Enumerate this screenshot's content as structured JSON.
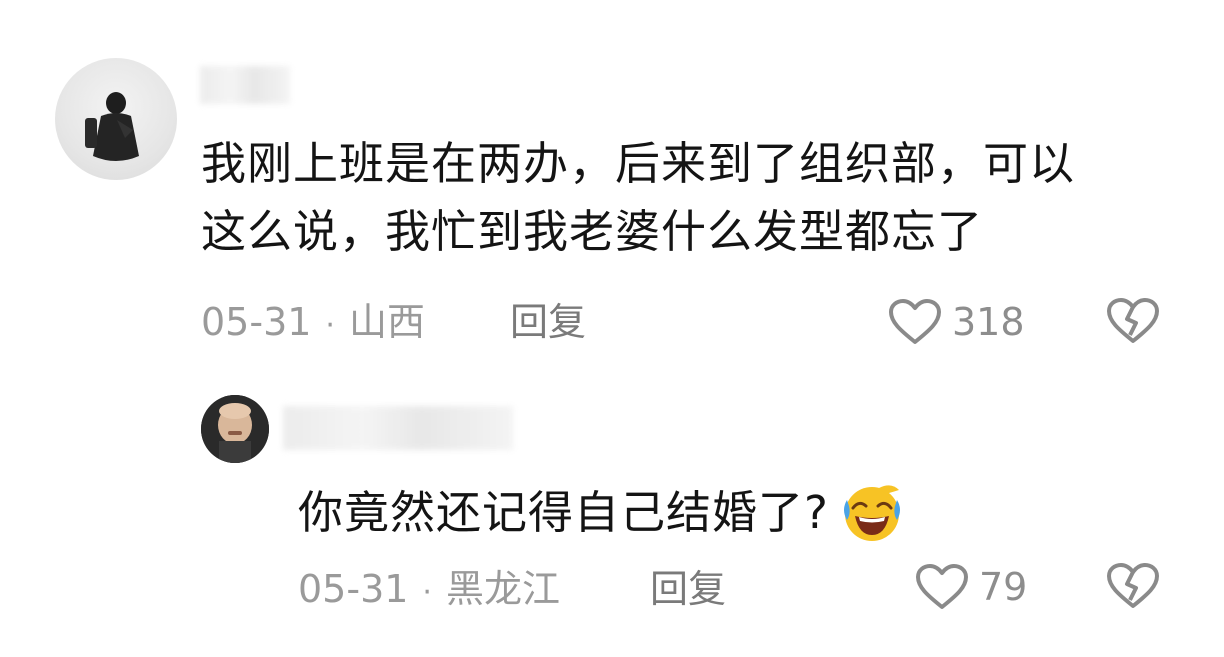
{
  "comment": {
    "text_line1": "我刚上班是在两办，后来到了组织部，可以",
    "text_line2": "这么说，我忙到我老婆什么发型都忘了",
    "date": "05-31",
    "location": "山西",
    "reply_label": "回复",
    "like_count": "318"
  },
  "reply": {
    "text": "你竟然还记得自己结婚了?",
    "emoji": "grinning-tears-emoji",
    "date": "05-31",
    "location": "黑龙江",
    "reply_label": "回复",
    "like_count": "79"
  },
  "icons": {
    "like": "heart-outline-icon",
    "dislike": "broken-heart-icon"
  },
  "colors": {
    "text": "#141414",
    "meta": "#9a9a9a",
    "icon": "#8a8a8a",
    "emoji_face": "#f7c325",
    "emoji_tear": "#4aa3e6"
  }
}
